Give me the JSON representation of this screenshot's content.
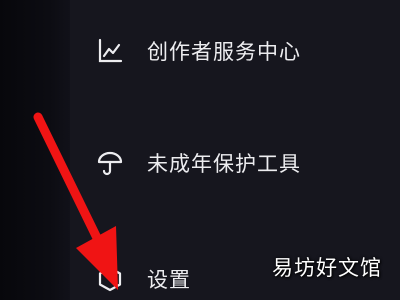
{
  "menu": {
    "items": [
      {
        "label": "创作者服务中心",
        "icon": "chart-trend-icon"
      },
      {
        "label": "未成年保护工具",
        "icon": "umbrella-icon"
      },
      {
        "label": "设置",
        "icon": "settings-hexagon-icon"
      }
    ]
  },
  "overlay": {
    "arrow_color": "#f01414",
    "watermark": "易坊好文馆"
  },
  "colors": {
    "background": "#16161e",
    "text": "#ededf0"
  }
}
